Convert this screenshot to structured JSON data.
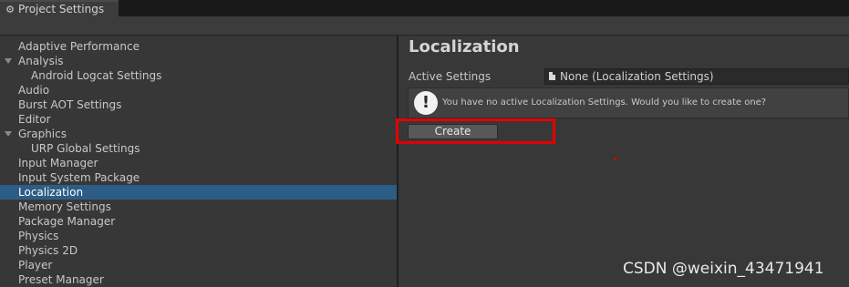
{
  "window": {
    "tab_title": "Project Settings",
    "tab_icon": "gear-icon"
  },
  "sidebar": {
    "items": [
      {
        "label": "Adaptive Performance",
        "indent": 0,
        "foldout": false,
        "selected": false
      },
      {
        "label": "Analysis",
        "indent": 0,
        "foldout": true,
        "selected": false
      },
      {
        "label": "Android Logcat Settings",
        "indent": 1,
        "foldout": false,
        "selected": false
      },
      {
        "label": "Audio",
        "indent": 0,
        "foldout": false,
        "selected": false
      },
      {
        "label": "Burst AOT Settings",
        "indent": 0,
        "foldout": false,
        "selected": false
      },
      {
        "label": "Editor",
        "indent": 0,
        "foldout": false,
        "selected": false
      },
      {
        "label": "Graphics",
        "indent": 0,
        "foldout": true,
        "selected": false
      },
      {
        "label": "URP Global Settings",
        "indent": 1,
        "foldout": false,
        "selected": false
      },
      {
        "label": "Input Manager",
        "indent": 0,
        "foldout": false,
        "selected": false
      },
      {
        "label": "Input System Package",
        "indent": 0,
        "foldout": false,
        "selected": false
      },
      {
        "label": "Localization",
        "indent": 0,
        "foldout": false,
        "selected": true
      },
      {
        "label": "Memory Settings",
        "indent": 0,
        "foldout": false,
        "selected": false
      },
      {
        "label": "Package Manager",
        "indent": 0,
        "foldout": false,
        "selected": false
      },
      {
        "label": "Physics",
        "indent": 0,
        "foldout": false,
        "selected": false
      },
      {
        "label": "Physics 2D",
        "indent": 0,
        "foldout": false,
        "selected": false
      },
      {
        "label": "Player",
        "indent": 0,
        "foldout": false,
        "selected": false
      },
      {
        "label": "Preset Manager",
        "indent": 0,
        "foldout": false,
        "selected": false
      }
    ]
  },
  "main": {
    "title": "Localization",
    "active_settings_label": "Active Settings",
    "active_settings_value": "None (Localization Settings)",
    "help_message": "You have no active Localization Settings. Would you like to create one?",
    "create_label": "Create"
  },
  "watermark": "CSDN @weixin_43471941",
  "colors": {
    "selection": "#2c5d87",
    "highlight_box": "#e30000",
    "background": "#383838"
  }
}
